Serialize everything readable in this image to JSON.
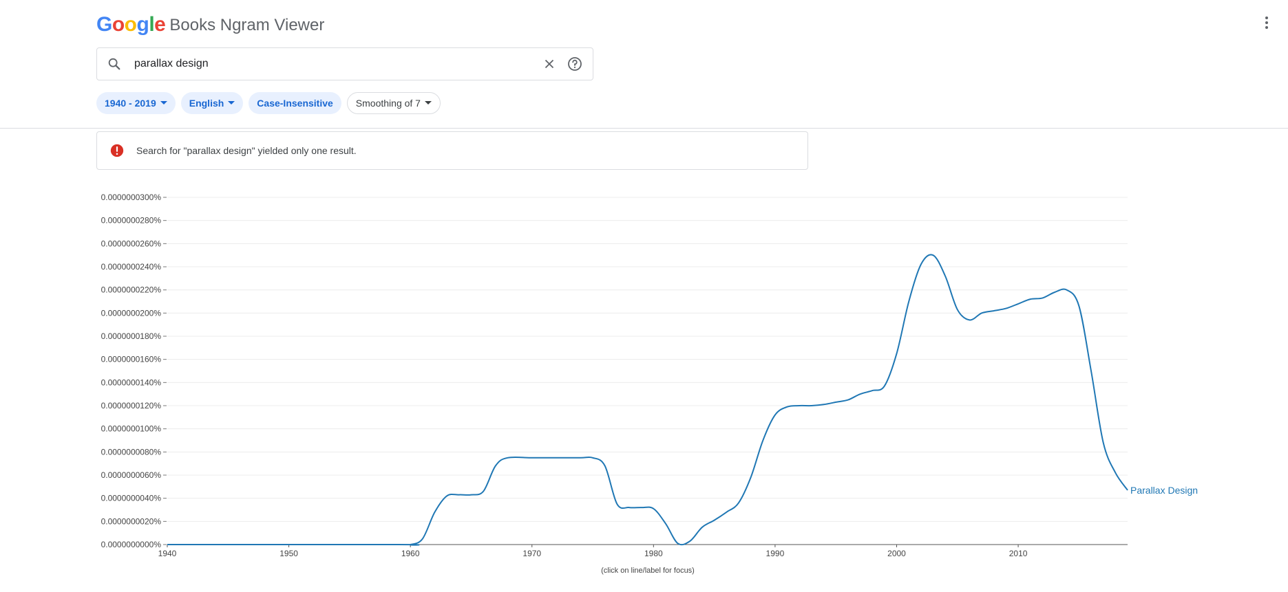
{
  "header": {
    "logo_letters": [
      "G",
      "o",
      "o",
      "g",
      "l",
      "e"
    ],
    "logo_colors": [
      "#4285F4",
      "#EA4335",
      "#FBBC05",
      "#4285F4",
      "#34A853",
      "#EA4335"
    ],
    "product_name": "Books Ngram Viewer",
    "menu_icon": "more-vert-icon"
  },
  "search": {
    "value": "parallax design",
    "icons": [
      "search-icon",
      "clear-icon",
      "help-icon"
    ]
  },
  "filters": {
    "year_range": "1940 - 2019",
    "corpus": "English",
    "case": "Case-Insensitive",
    "smoothing": "Smoothing of 7"
  },
  "alert": {
    "icon": "error-icon",
    "icon_color": "#d93025",
    "text": "Search for \"parallax design\" yielded only one result."
  },
  "chart_data": {
    "type": "line",
    "xlim": [
      1940,
      2019
    ],
    "ylim": [
      0,
      3e-10
    ],
    "x_ticks": [
      1940,
      1950,
      1960,
      1970,
      1980,
      1990,
      2000,
      2010
    ],
    "y_ticks": [
      0,
      2e-11,
      4e-11,
      6e-11,
      8e-11,
      1e-10,
      1.2e-10,
      1.4e-10,
      1.6e-10,
      1.8e-10,
      2e-10,
      2.2e-10,
      2.4e-10,
      2.6e-10,
      2.8e-10,
      3e-10
    ],
    "y_tick_labels": [
      "0.0000000000%",
      "0.0000000020%",
      "0.0000000040%",
      "0.0000000060%",
      "0.0000000080%",
      "0.0000000100%",
      "0.0000000120%",
      "0.0000000140%",
      "0.0000000160%",
      "0.0000000180%",
      "0.0000000200%",
      "0.0000000220%",
      "0.0000000240%",
      "0.0000000260%",
      "0.0000000280%",
      "0.0000000300%"
    ],
    "grid": true,
    "footnote": "(click on line/label for focus)",
    "series": [
      {
        "name": "Parallax Design",
        "color": "#1f77b4",
        "points": [
          [
            1940,
            0
          ],
          [
            1959,
            0
          ],
          [
            1960,
            0
          ],
          [
            1961,
            0.005
          ],
          [
            1962,
            0.028
          ],
          [
            1963,
            0.042
          ],
          [
            1964,
            0.043
          ],
          [
            1965,
            0.043
          ],
          [
            1966,
            0.046
          ],
          [
            1967,
            0.068
          ],
          [
            1968,
            0.075
          ],
          [
            1970,
            0.075
          ],
          [
            1972,
            0.075
          ],
          [
            1974,
            0.075
          ],
          [
            1975,
            0.075
          ],
          [
            1976,
            0.068
          ],
          [
            1977,
            0.035
          ],
          [
            1978,
            0.032
          ],
          [
            1979,
            0.032
          ],
          [
            1980,
            0.031
          ],
          [
            1981,
            0.018
          ],
          [
            1982,
            0.001
          ],
          [
            1983,
            0.003
          ],
          [
            1984,
            0.015
          ],
          [
            1985,
            0.021
          ],
          [
            1986,
            0.028
          ],
          [
            1987,
            0.036
          ],
          [
            1988,
            0.058
          ],
          [
            1989,
            0.09
          ],
          [
            1990,
            0.112
          ],
          [
            1991,
            0.119
          ],
          [
            1992,
            0.12
          ],
          [
            1993,
            0.12
          ],
          [
            1994,
            0.121
          ],
          [
            1995,
            0.123
          ],
          [
            1996,
            0.125
          ],
          [
            1997,
            0.13
          ],
          [
            1998,
            0.133
          ],
          [
            1999,
            0.137
          ],
          [
            2000,
            0.165
          ],
          [
            2001,
            0.21
          ],
          [
            2002,
            0.242
          ],
          [
            2003,
            0.25
          ],
          [
            2004,
            0.232
          ],
          [
            2005,
            0.203
          ],
          [
            2006,
            0.194
          ],
          [
            2007,
            0.2
          ],
          [
            2008,
            0.202
          ],
          [
            2009,
            0.204
          ],
          [
            2010,
            0.208
          ],
          [
            2011,
            0.212
          ],
          [
            2012,
            0.213
          ],
          [
            2013,
            0.218
          ],
          [
            2014,
            0.22
          ],
          [
            2015,
            0.206
          ],
          [
            2016,
            0.15
          ],
          [
            2017,
            0.088
          ],
          [
            2018,
            0.062
          ],
          [
            2019,
            0.047
          ]
        ],
        "points_unit": "×1e-9 (fraction of percent)"
      }
    ]
  }
}
